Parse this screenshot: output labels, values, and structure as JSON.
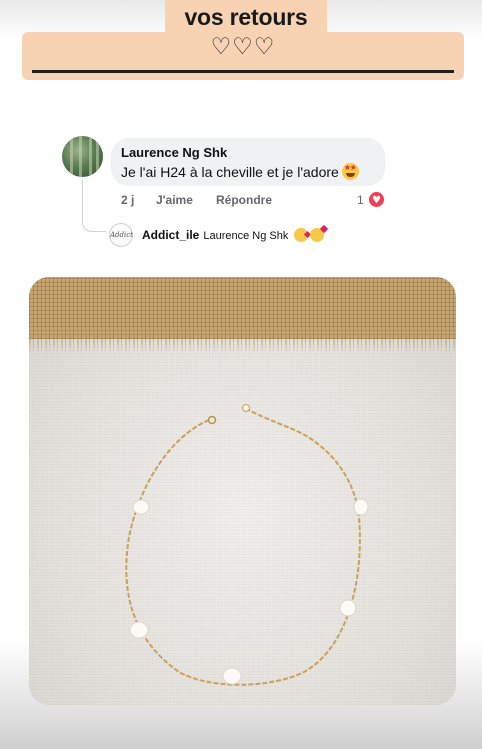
{
  "header": {
    "title": "vos retours",
    "hearts": "♡♡♡"
  },
  "comment": {
    "author": "Laurence Ng Shk",
    "text": "Je l'ai H24 à la cheville et je l'adore",
    "time": "2 j",
    "like_label": "J'aime",
    "reply_label": "Répondre",
    "like_count": "1",
    "heart_glyph": "♥"
  },
  "reply": {
    "author": "Addict_ile",
    "mention": "Laurence Ng Shk",
    "avatar_text": "Addict"
  },
  "colors": {
    "banner": "#f8d3b3",
    "bubble": "#eff1f3",
    "reaction_heart": "#f33e58"
  }
}
